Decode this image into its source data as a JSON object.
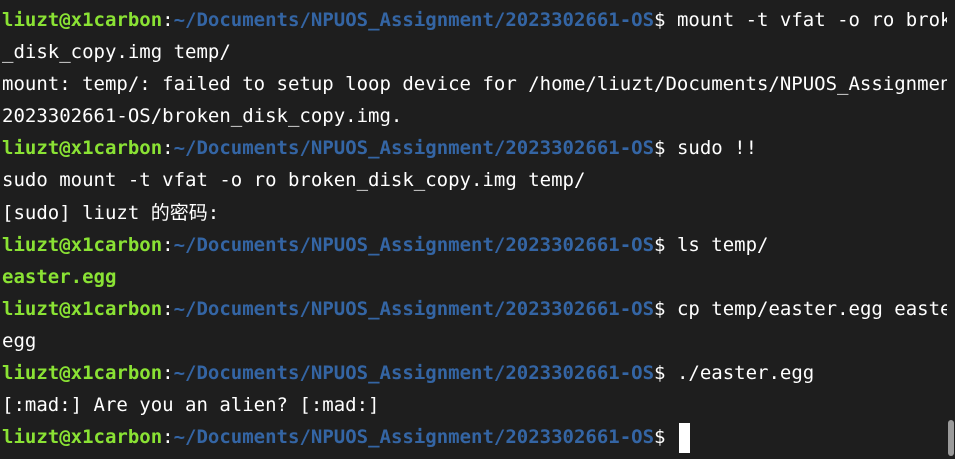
{
  "prompt": {
    "user_host": "liuzt@x1carbon",
    "separator": ":",
    "path": "~/Documents/NPUOS_Assignment/2023302661-OS",
    "symbol": "$"
  },
  "lines": {
    "l0_cmd": " mount -t vfat -o ro broken",
    "l1": "_disk_copy.img temp/",
    "l2": "mount: temp/: failed to setup loop device for /home/liuzt/Documents/NPUOS_Assignment/",
    "l3": "2023302661-OS/broken_disk_copy.img.",
    "l4_cmd": " sudo !!",
    "l5": "sudo mount -t vfat -o ro broken_disk_copy.img temp/",
    "l6": "[sudo] liuzt 的密码:",
    "l7_cmd": " ls temp/",
    "l8": "easter.egg",
    "l9_cmd": " cp temp/easter.egg easter.",
    "l10": "egg",
    "l11_cmd": " ./easter.egg",
    "l12": "[:mad:] Are you an alien? [:mad:]",
    "l13_cmd": " "
  },
  "colors": {
    "background": "#1e1e1e",
    "user_host": "#8ae234",
    "path": "#3465a4",
    "text": "#ffffff"
  }
}
